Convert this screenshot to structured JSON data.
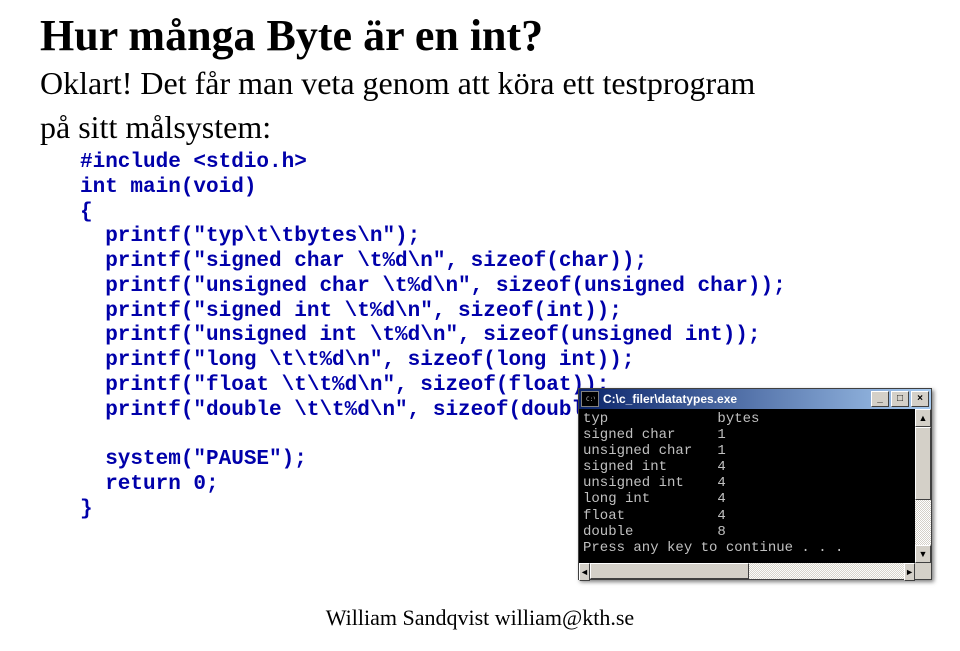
{
  "title": "Hur många Byte är en int?",
  "intro_line1": "Oklart!  Det får man veta genom att köra ett testprogram",
  "intro_line2": "på sitt målsystem:",
  "code": "#include <stdio.h>\nint main(void)\n{\n  printf(\"typ\\t\\tbytes\\n\");\n  printf(\"signed char \\t%d\\n\", sizeof(char));\n  printf(\"unsigned char \\t%d\\n\", sizeof(unsigned char));\n  printf(\"signed int \\t%d\\n\", sizeof(int));\n  printf(\"unsigned int \\t%d\\n\", sizeof(unsigned int));\n  printf(\"long \\t\\t%d\\n\", sizeof(long int));\n  printf(\"float \\t\\t%d\\n\", sizeof(float));\n  printf(\"double \\t\\t%d\\n\", sizeof(double));\n\n  system(\"PAUSE\");\n  return 0;\n}",
  "console": {
    "title": "C:\\c_filer\\datatypes.exe",
    "output": "typ             bytes\nsigned char     1\nunsigned char   1\nsigned int      4\nunsigned int    4\nlong int        4\nfloat           4\ndouble          8\nPress any key to continue . . ."
  },
  "footer": "William Sandqvist  william@kth.se",
  "icons": {
    "minimize": "_",
    "maximize": "□",
    "close": "×",
    "up": "▲",
    "down": "▼",
    "left": "◄",
    "right": "►"
  }
}
